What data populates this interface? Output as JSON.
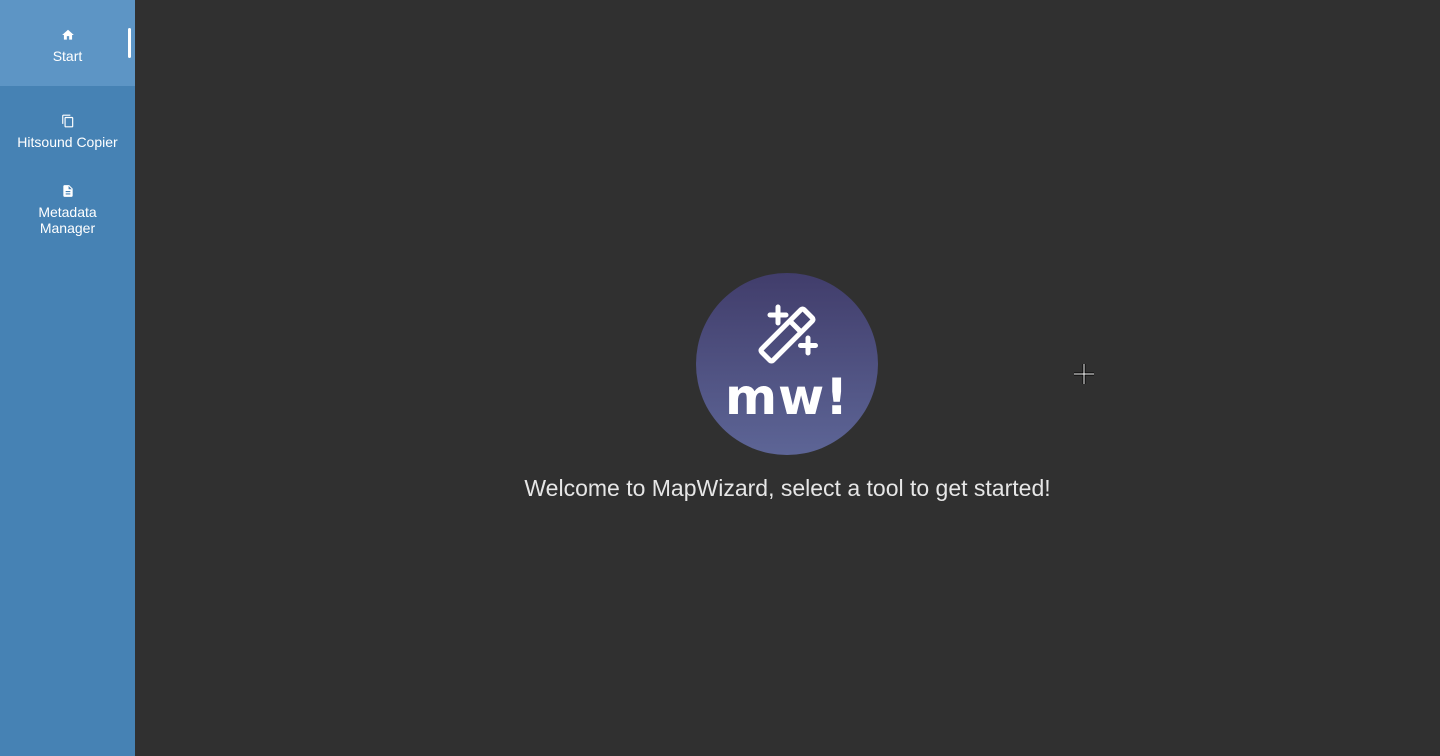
{
  "sidebar": {
    "items": [
      {
        "label": "Start",
        "icon": "home-icon",
        "active": true
      },
      {
        "label": "Hitsound Copier",
        "icon": "copy-icon",
        "active": false
      },
      {
        "label": "Metadata Manager",
        "icon": "document-icon",
        "active": false
      }
    ]
  },
  "main": {
    "logo": {
      "text": "mw!",
      "icon": "magic-wand-icon"
    },
    "welcome_text": "Welcome to MapWizard, select a tool to get started!"
  },
  "colors": {
    "sidebar_bg": "#4682b4",
    "sidebar_active_bg": "#5d95c5",
    "main_bg": "#303030",
    "logo_gradient_top": "#413d6b",
    "logo_gradient_bottom": "#5d6596",
    "text": "#e6e6e6"
  }
}
